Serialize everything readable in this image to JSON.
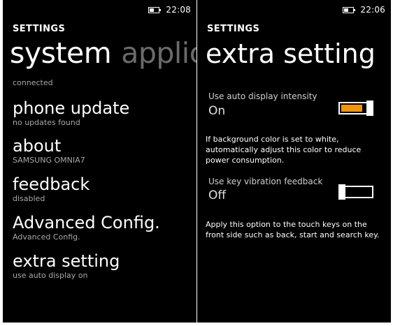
{
  "left_screen": {
    "time": "22:08",
    "header": "SETTINGS",
    "pivot": {
      "active": "system",
      "inactive": "applica"
    },
    "top_sub": "connected",
    "items": [
      {
        "title": "phone update",
        "sub": "no updates found"
      },
      {
        "title": "about",
        "sub": "SAMSUNG OMNIA7"
      },
      {
        "title": "feedback",
        "sub": "disabled"
      },
      {
        "title": "Advanced Config.",
        "sub": "Advanced Config."
      },
      {
        "title": "extra setting",
        "sub": "use auto display on"
      }
    ]
  },
  "right_screen": {
    "time": "22:06",
    "header": "SETTINGS",
    "title": "extra setting",
    "options": [
      {
        "label": "Use auto display intensity",
        "value": "On",
        "state": "on",
        "description": "If background color is set to white, automatically adjust this color to reduce power consumption."
      },
      {
        "label": "Use key vibration feedback",
        "value": "Off",
        "state": "off",
        "description": "Apply this option to the touch keys on the front side such as back, start and search key."
      }
    ]
  },
  "colors": {
    "accent": "#f0960e",
    "background": "#000000",
    "text": "#ffffff",
    "inactive": "#6b6b6b"
  },
  "icons": [
    "battery-icon"
  ],
  "battery_level": 0.5
}
